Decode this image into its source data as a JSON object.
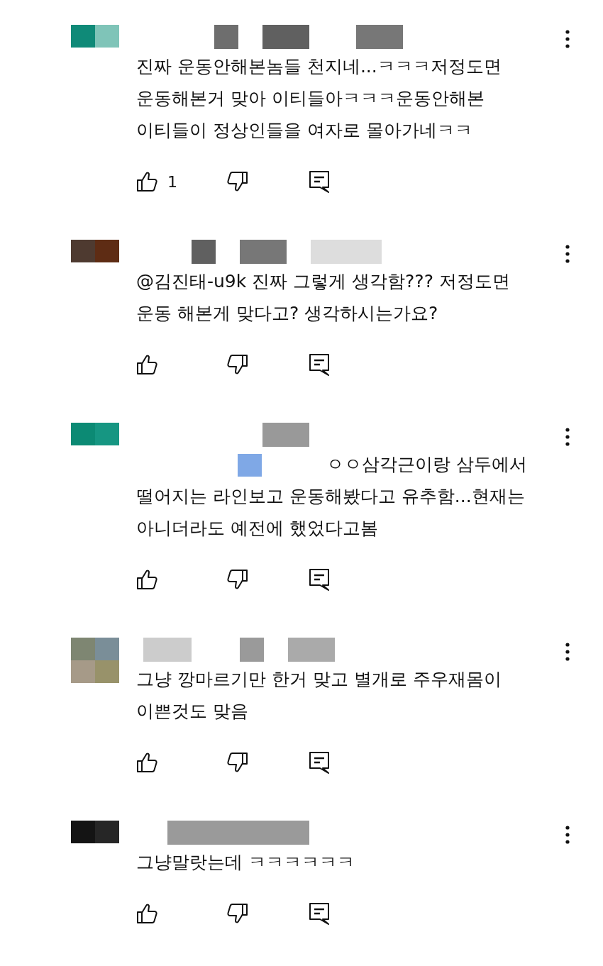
{
  "comments": [
    {
      "hidden_mention": false,
      "text": "진짜 운동안해본놈들 천지네...ㅋㅋㅋ저정도면 운동해본거 맞아 이티들아ㅋㅋㅋ운동안해본 이티들이 정상인들을 여자로 몰아가네ㅋㅋ",
      "likes": "1"
    },
    {
      "hidden_mention": false,
      "text": "@김진태-u9k  진짜 그렇게 생각함??? 저정도면 운동 해본게 맞다고? 생각하시는가요?"
    },
    {
      "hidden_mention": true,
      "text": "ㅇㅇ삼각근이랑 삼두에서 떨어지는 라인보고 운동해봤다고 유추함...현재는 아니더라도 예전에 했었다고봄"
    },
    {
      "hidden_mention": false,
      "text": "그냥 깡마르기만 한거 맞고 별개로 주우재몸이 이쁜것도 맞음"
    },
    {
      "hidden_mention": false,
      "text": "그냥말랏는데 ㅋㅋㅋㅋㅋㅋ"
    }
  ]
}
